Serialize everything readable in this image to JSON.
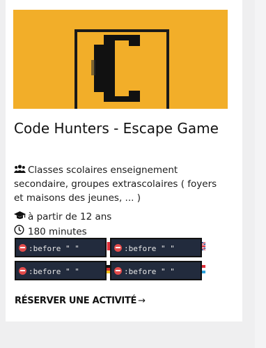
{
  "card": {
    "title": "Code Hunters - Escape Game",
    "audience": "Classes scolaires enseignement secondaire, groupes extrascolaires ( foyers et maisons des jeunes, ... )",
    "age": "à partir de 12 ans",
    "duration": "180 minutes",
    "cta": "RÉSERVER UNE ACTIVITÉ",
    "cta_arrow": "→",
    "hero_color": "#f2ae29",
    "icons": {
      "audience": "users-icon",
      "age": "graduation-cap-icon",
      "duration": "clock-icon"
    }
  },
  "language_flags": {
    "tooltip_text": ":before \" \"",
    "items": [
      {
        "flag": "fr-flag-icon"
      },
      {
        "flag": "uk-flag-icon"
      },
      {
        "flag": "de-flag-icon"
      },
      {
        "flag": "lu-flag-icon"
      }
    ]
  }
}
